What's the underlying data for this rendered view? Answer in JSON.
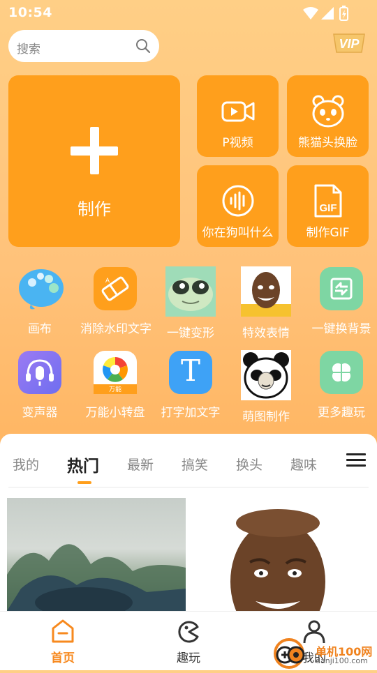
{
  "status": {
    "time": "10:54"
  },
  "search": {
    "placeholder": "搜索"
  },
  "vip_label": "VIP",
  "big_tile": {
    "label": "制作"
  },
  "tiles": [
    {
      "label": "P视频",
      "icon": "video-camera-icon"
    },
    {
      "label": "熊猫头换脸",
      "icon": "panda-icon"
    },
    {
      "label": "你在狗叫什么",
      "icon": "voice-wave-icon"
    },
    {
      "label": "制作GIF",
      "icon": "gif-file-icon"
    }
  ],
  "grid": [
    {
      "label": "画布",
      "icon": "palette-icon"
    },
    {
      "label": "消除水印文字",
      "icon": "eraser-icon"
    },
    {
      "label": "一键变形",
      "icon": "frog-meme-icon"
    },
    {
      "label": "特效表情",
      "icon": "face-meme-icon"
    },
    {
      "label": "一键换背景",
      "icon": "swap-background-icon"
    },
    {
      "label": "变声器",
      "icon": "microphone-headset-icon"
    },
    {
      "label": "万能小转盘",
      "icon": "spinner-wheel-icon",
      "badge": "万能"
    },
    {
      "label": "打字加文字",
      "icon": "text-t-icon",
      "glyph": "T"
    },
    {
      "label": "萌图制作",
      "icon": "panda-meme-icon"
    },
    {
      "label": "更多趣玩",
      "icon": "more-grid-icon"
    }
  ],
  "tabs": [
    "我的",
    "热门",
    "最新",
    "搞笑",
    "换头",
    "趣味"
  ],
  "active_tab": "热门",
  "nav": [
    {
      "label": "首页",
      "icon": "home-icon",
      "active": true
    },
    {
      "label": "趣玩",
      "icon": "pacman-icon",
      "active": false
    },
    {
      "label": "我的",
      "icon": "user-icon",
      "active": false
    }
  ],
  "watermark": {
    "line1": "单机100网",
    "line2": "danji100.com"
  },
  "colors": {
    "accent": "#ff9f1c",
    "active_nav": "#f7891e"
  }
}
